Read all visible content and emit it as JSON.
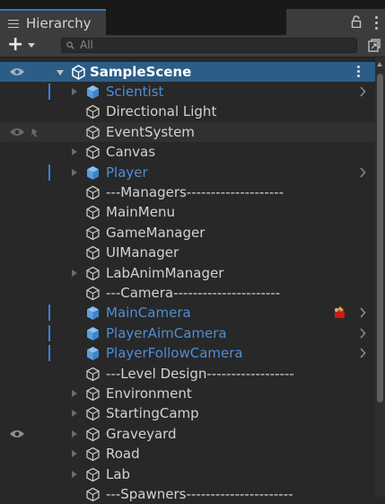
{
  "window": {
    "tab_label": "Hierarchy"
  },
  "toolbar": {
    "add_label": "+",
    "search_placeholder": "All"
  },
  "scene": {
    "name": "SampleScene"
  },
  "items": [
    {
      "label": "Scientist",
      "type": "prefab",
      "foldout": true,
      "selected": true,
      "chevron": true
    },
    {
      "label": "Directional Light",
      "type": "object",
      "foldout": false
    },
    {
      "label": "EventSystem",
      "type": "object",
      "foldout": false,
      "hidden_pickable_toggle": true
    },
    {
      "label": "Canvas",
      "type": "object",
      "foldout": true
    },
    {
      "label": "Player",
      "type": "prefab",
      "foldout": true,
      "selected": true,
      "chevron": true
    },
    {
      "label": "---Managers--------------------",
      "type": "object",
      "foldout": false
    },
    {
      "label": "MainMenu",
      "type": "object",
      "foldout": false
    },
    {
      "label": "GameManager",
      "type": "object",
      "foldout": false
    },
    {
      "label": "UIManager",
      "type": "object",
      "foldout": false
    },
    {
      "label": "LabAnimManager",
      "type": "object",
      "foldout": true
    },
    {
      "label": "---Camera----------------------",
      "type": "object",
      "foldout": false
    },
    {
      "label": "MainCamera",
      "type": "prefab",
      "foldout": false,
      "selected": true,
      "chevron": true,
      "warning": true
    },
    {
      "label": "PlayerAimCamera",
      "type": "prefab",
      "foldout": false,
      "selected": true,
      "chevron": true
    },
    {
      "label": "PlayerFollowCamera",
      "type": "prefab",
      "foldout": false,
      "selected": true,
      "chevron": true
    },
    {
      "label": "---Level Design------------------",
      "type": "object",
      "foldout": false
    },
    {
      "label": "Environment",
      "type": "object",
      "foldout": true
    },
    {
      "label": "StartingCamp",
      "type": "object",
      "foldout": true
    },
    {
      "label": "Graveyard",
      "type": "object",
      "foldout": true,
      "hidden_eye": true
    },
    {
      "label": "Road",
      "type": "object",
      "foldout": true
    },
    {
      "label": "Lab",
      "type": "object",
      "foldout": true
    },
    {
      "label": "---Spawners----------------------",
      "type": "object",
      "foldout": false
    }
  ],
  "colors": {
    "accent": "#3c7ee0",
    "prefab_text": "#4d8ed8",
    "scene_row": "#2c5d87",
    "panel_bg": "#282828"
  }
}
